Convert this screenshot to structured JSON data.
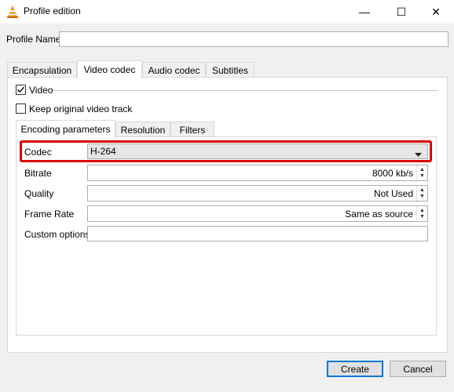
{
  "window": {
    "title": "Profile edition",
    "minimize_glyph": "—",
    "maximize_glyph": "☐",
    "close_glyph": "✕",
    "icon": "vlc-cone-icon"
  },
  "profile": {
    "label": "Profile Name",
    "value": ""
  },
  "tabs": [
    {
      "label": "Encapsulation",
      "active": false
    },
    {
      "label": "Video codec",
      "active": true
    },
    {
      "label": "Audio codec",
      "active": false
    },
    {
      "label": "Subtitles",
      "active": false
    }
  ],
  "video": {
    "checkbox_label": "Video",
    "checked": true,
    "keep_original_label": "Keep original video track",
    "keep_original_checked": false
  },
  "subtabs": [
    {
      "label": "Encoding parameters",
      "active": true
    },
    {
      "label": "Resolution",
      "active": false
    },
    {
      "label": "Filters",
      "active": false
    }
  ],
  "params": {
    "codec": {
      "label": "Codec",
      "value": "H-264"
    },
    "bitrate": {
      "label": "Bitrate",
      "value": "8000 kb/s"
    },
    "quality": {
      "label": "Quality",
      "value": "Not Used"
    },
    "frame_rate": {
      "label": "Frame Rate",
      "value": "Same as source"
    },
    "custom": {
      "label": "Custom options",
      "value": ""
    }
  },
  "buttons": {
    "create": "Create",
    "cancel": "Cancel"
  },
  "colors": {
    "highlight": "#d90000",
    "default_button_border": "#0078d7"
  }
}
